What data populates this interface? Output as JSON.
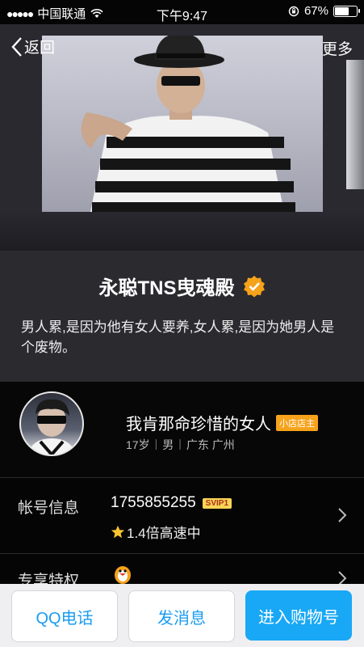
{
  "status_bar": {
    "signal_dots": "●●●●●",
    "carrier": "中国联通",
    "time": "下午9:47",
    "battery_percent": "67%",
    "battery_level": 0.67
  },
  "nav": {
    "back_label": "返回",
    "more_label": "更多"
  },
  "shop": {
    "name": "永聪TNS曳魂殿",
    "description": " 男人累,是因为他有女人要养,女人累,是因为她男人是个废物。"
  },
  "profile": {
    "nickname": "我肯那命珍惜的女人",
    "shop_badge": "小店店主",
    "age": "17岁",
    "gender": "男",
    "region": "广东 广州"
  },
  "account": {
    "label": "帐号信息",
    "qq_number": "1755855255",
    "svip_badge": "SVIP1",
    "speed_text": "1.4倍高速中"
  },
  "privileges": {
    "label": "专享特权"
  },
  "actions": {
    "call_label": "QQ电话",
    "message_label": "发消息",
    "shop_label": "进入购物号"
  },
  "colors": {
    "accent_blue": "#19a8f5",
    "verify_orange": "#f6a21b",
    "shop_badge_orange": "#f6a21b"
  }
}
